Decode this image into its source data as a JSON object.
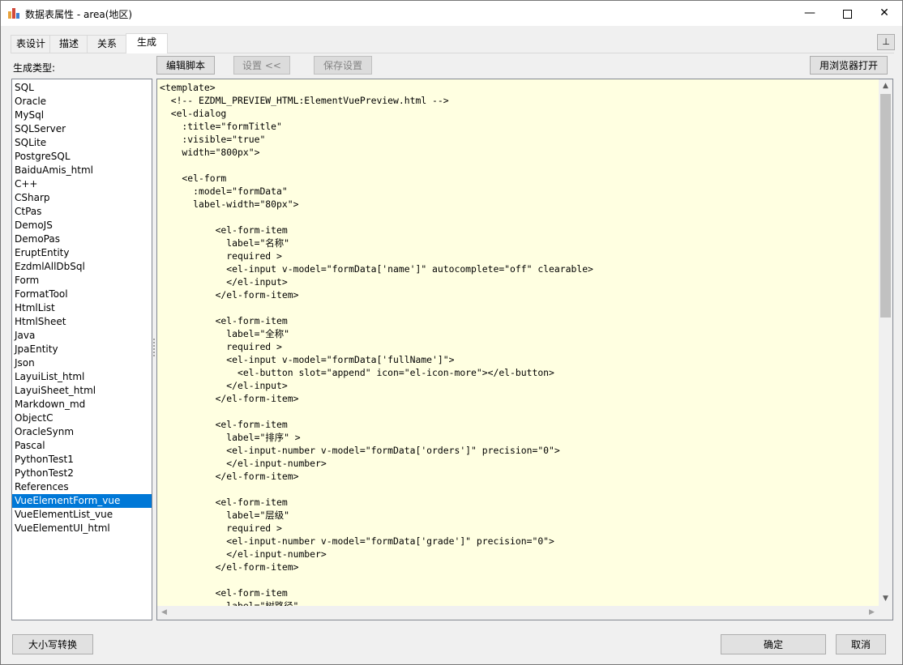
{
  "window": {
    "title": "数据表属性 - area(地区)",
    "min_glyph": "—",
    "close_glyph": "✕"
  },
  "tabs": [
    {
      "label": "表设计",
      "active": false
    },
    {
      "label": "描述",
      "active": false
    },
    {
      "label": "关系",
      "active": false
    },
    {
      "label": "生成",
      "active": true
    }
  ],
  "pin_glyph": "⊥",
  "toolbar": {
    "gen_type_label": "生成类型:",
    "edit_script": "编辑脚本",
    "settings": "设置 <<",
    "save_settings": "保存设置",
    "open_browser": "用浏览器打开"
  },
  "gen_types": [
    "SQL",
    "Oracle",
    "MySql",
    "SQLServer",
    "SQLite",
    "PostgreSQL",
    "BaiduAmis_html",
    "C++",
    "CSharp",
    "CtPas",
    "DemoJS",
    "DemoPas",
    "EruptEntity",
    "EzdmlAllDbSql",
    "Form",
    "FormatTool",
    "HtmlList",
    "HtmlSheet",
    "Java",
    "JpaEntity",
    "Json",
    "LayuiList_html",
    "LayuiSheet_html",
    "Markdown_md",
    "ObjectC",
    "OracleSynm",
    "Pascal",
    "PythonTest1",
    "PythonTest2",
    "References",
    "VueElementForm_vue",
    "VueElementList_vue",
    "VueElementUI_html"
  ],
  "selected_type": "VueElementForm_vue",
  "code": "<template>\n  <!-- EZDML_PREVIEW_HTML:ElementVuePreview.html -->\n  <el-dialog\n    :title=\"formTitle\"\n    :visible=\"true\"\n    width=\"800px\">\n\n    <el-form\n      :model=\"formData\"\n      label-width=\"80px\">\n\n          <el-form-item\n            label=\"名称\"\n            required >\n            <el-input v-model=\"formData['name']\" autocomplete=\"off\" clearable>\n            </el-input>\n          </el-form-item>\n\n          <el-form-item\n            label=\"全称\"\n            required >\n            <el-input v-model=\"formData['fullName']\">\n              <el-button slot=\"append\" icon=\"el-icon-more\"></el-button>\n            </el-input>\n          </el-form-item>\n\n          <el-form-item\n            label=\"排序\" >\n            <el-input-number v-model=\"formData['orders']\" precision=\"0\">\n            </el-input-number>\n          </el-form-item>\n\n          <el-form-item\n            label=\"层级\"\n            required >\n            <el-input-number v-model=\"formData['grade']\" precision=\"0\">\n            </el-input-number>\n          </el-form-item>\n\n          <el-form-item\n            label=\"树路径\"",
  "scroll": {
    "up": "▲",
    "down": "▼",
    "left": "◀",
    "right": "▶"
  },
  "footer": {
    "case_convert": "大小写转换",
    "ok": "确定",
    "cancel": "取消"
  }
}
